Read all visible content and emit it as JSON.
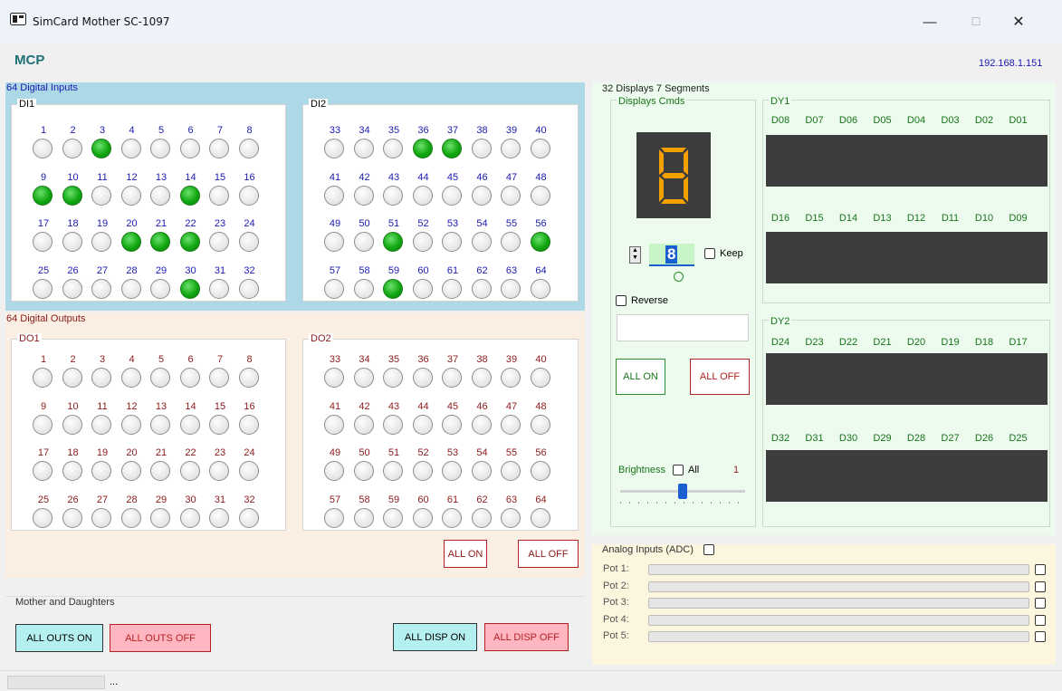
{
  "window": {
    "title": "SimCard Mother SC-1097",
    "minimize_glyph": "—",
    "maximize_glyph": "☐",
    "close_glyph": "✕",
    "icon": "app-card-icon"
  },
  "header": {
    "app_label": "MCP",
    "ip_address": "192.168.1.151"
  },
  "digital_inputs": {
    "title": "64 Digital Inputs",
    "group1": {
      "title": "DI1",
      "numbers": [
        "1",
        "2",
        "3",
        "4",
        "5",
        "6",
        "7",
        "8",
        "9",
        "10",
        "11",
        "12",
        "13",
        "14",
        "15",
        "16",
        "17",
        "18",
        "19",
        "20",
        "21",
        "22",
        "23",
        "24",
        "25",
        "26",
        "27",
        "28",
        "29",
        "30",
        "31",
        "32"
      ],
      "active": [
        3,
        9,
        10,
        14,
        20,
        21,
        22,
        30
      ]
    },
    "group2": {
      "title": "DI2",
      "numbers": [
        "33",
        "34",
        "35",
        "36",
        "37",
        "38",
        "39",
        "40",
        "41",
        "42",
        "43",
        "44",
        "45",
        "46",
        "47",
        "48",
        "49",
        "50",
        "51",
        "52",
        "53",
        "54",
        "55",
        "56",
        "57",
        "58",
        "59",
        "60",
        "61",
        "62",
        "63",
        "64"
      ],
      "active": [
        36,
        37,
        51,
        56,
        59
      ]
    },
    "number_color": "#1a1ab0"
  },
  "digital_outputs": {
    "title": "64 Digital Outputs",
    "group1": {
      "title": "DO1",
      "numbers": [
        "1",
        "2",
        "3",
        "4",
        "5",
        "6",
        "7",
        "8",
        "9",
        "10",
        "11",
        "12",
        "13",
        "14",
        "15",
        "16",
        "17",
        "18",
        "19",
        "20",
        "21",
        "22",
        "23",
        "24",
        "25",
        "26",
        "27",
        "28",
        "29",
        "30",
        "31",
        "32"
      ],
      "active": []
    },
    "group2": {
      "title": "DO2",
      "numbers": [
        "33",
        "34",
        "35",
        "36",
        "37",
        "38",
        "39",
        "40",
        "41",
        "42",
        "43",
        "44",
        "45",
        "46",
        "47",
        "48",
        "49",
        "50",
        "51",
        "52",
        "53",
        "54",
        "55",
        "56",
        "57",
        "58",
        "59",
        "60",
        "61",
        "62",
        "63",
        "64"
      ],
      "active": []
    },
    "number_color": "#8b1a1a",
    "all_on_label": "ALL ON",
    "all_off_label": "ALL OFF"
  },
  "mother_daughters": {
    "title": "Mother and Daughters",
    "all_outs_on": "ALL OUTS ON",
    "all_outs_off": "ALL OUTS OFF",
    "all_disp_on": "ALL DISP ON",
    "all_disp_off": "ALL DISP OFF"
  },
  "displays": {
    "title": "32 Displays 7 Segments",
    "cmds": {
      "title": "Displays Cmds",
      "digit_value": "8",
      "keep_label": "Keep",
      "reverse_label": "Reverse",
      "all_on_label": "ALL ON",
      "all_off_label": "ALL OFF",
      "brightness_label": "Brightness",
      "all_label": "All",
      "brightness_value": "1",
      "brightness_level_fraction": 0.5
    },
    "dy1": {
      "title": "DY1",
      "row1": [
        "D08",
        "D07",
        "D06",
        "D05",
        "D04",
        "D03",
        "D02",
        "D01"
      ],
      "row2": [
        "D16",
        "D15",
        "D14",
        "D13",
        "D12",
        "D11",
        "D10",
        "D09"
      ]
    },
    "dy2": {
      "title": "DY2",
      "row1": [
        "D24",
        "D23",
        "D22",
        "D21",
        "D20",
        "D19",
        "D18",
        "D17"
      ],
      "row2": [
        "D32",
        "D31",
        "D30",
        "D29",
        "D28",
        "D27",
        "D26",
        "D25"
      ]
    },
    "label_color": "#17741a",
    "segment_color": "#f5a000"
  },
  "analog": {
    "title": "Analog Inputs (ADC)",
    "pots": [
      "Pot 1:",
      "Pot 2:",
      "Pot 3:",
      "Pot 4:",
      "Pot 5:"
    ]
  },
  "status_bar": {
    "text": "..."
  }
}
